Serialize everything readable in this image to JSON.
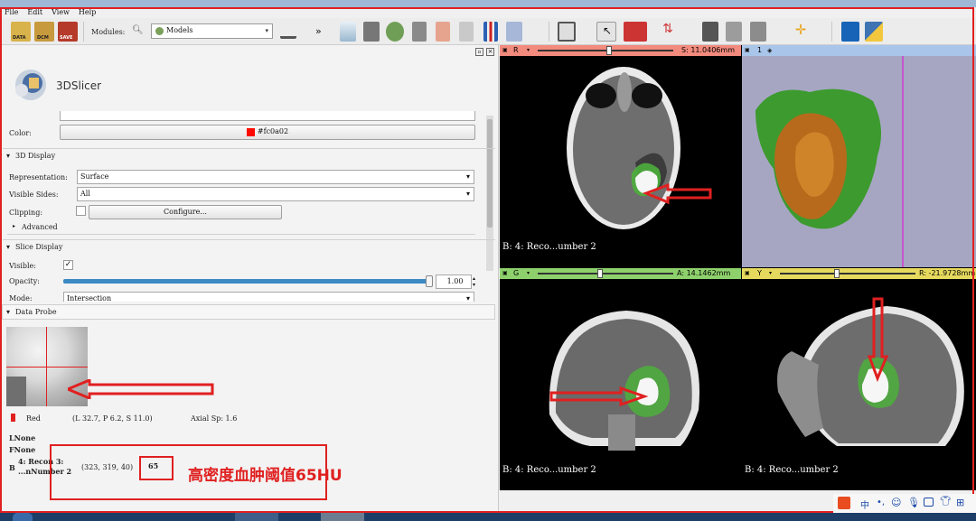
{
  "menu": [
    "File",
    "Edit",
    "View",
    "Help"
  ],
  "toolbar": {
    "data_label": "DATA",
    "dcm_label": "DCM",
    "save_label": "SAVE",
    "modules_label": "Modules:",
    "module_value": "Models",
    "more_glyph": "»"
  },
  "app_logo": "3DSlicer",
  "color_row": {
    "label": "Color:",
    "value": "#fc0a02",
    "swatch": "#fc0a02"
  },
  "display3d": {
    "header": "3D Display",
    "representation_label": "Representation:",
    "representation_value": "Surface",
    "visible_sides_label": "Visible Sides:",
    "visible_sides_value": "All",
    "clipping_label": "Clipping:",
    "configure_label": "Configure...",
    "advanced_label": "Advanced"
  },
  "slice_display": {
    "header": "Slice Display",
    "visible_label": "Visible:",
    "opacity_label": "Opacity:",
    "opacity_value": "1.00",
    "opacity_fraction": 1.0,
    "mode_label": "Mode:",
    "mode_value": "Intersection"
  },
  "data_probe": {
    "header": "Data Probe",
    "view_name": "Red",
    "ras": "(L 32.7, P 6.2, S 11.0)",
    "spacing": "Axial Sp: 1.6",
    "l_line": "LNone",
    "f_line": "FNone",
    "b_prefix": "B",
    "layer1": "4: Recon 3:",
    "layer2": "...nNumber 2",
    "ijk": "(323, 319, 40)",
    "value": "65"
  },
  "annotation": "高密度血肿阈值65HU",
  "views": {
    "red": {
      "letter": "R",
      "offset": "S: 11.0406mm",
      "label": "B: 4: Reco...umber 2",
      "color": "#f28a7e"
    },
    "threed": {
      "number": "1",
      "color": "#a9c6ea"
    },
    "green": {
      "letter": "G",
      "offset": "A: 14.1462mm",
      "label": "B: 4: Reco...umber 2",
      "color": "#8ed16c"
    },
    "yellow": {
      "letter": "Y",
      "offset": "R: -21.9728mm",
      "label": "B: 4: Reco...umber 2",
      "color": "#e6da5e"
    }
  },
  "tray": {
    "ime": "中"
  }
}
